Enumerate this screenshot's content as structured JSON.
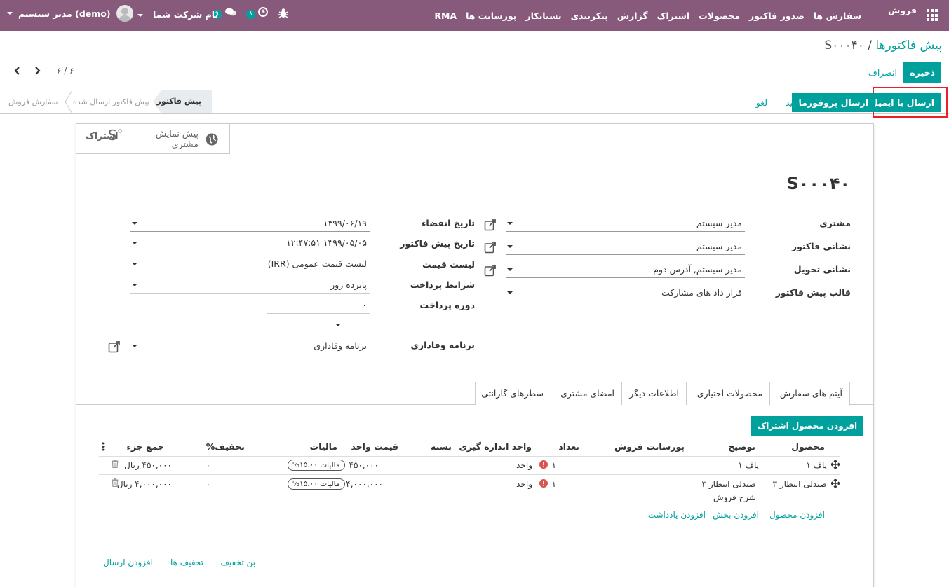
{
  "navbar": {
    "app_name": "فروش",
    "menu": [
      "سفارش ها",
      "صدور فاکتور",
      "محصولات",
      "اشتراک",
      "گزارش",
      "پیکربندی",
      "بستانکار",
      "پورسانت ها",
      "RMA"
    ],
    "user_name": "مدیر سیستم (demo)",
    "company_name": "نام شرکت شما",
    "messages_count": "۹",
    "activities_count": "۸"
  },
  "breadcrumb": {
    "parent": "پیش فاکتورها",
    "separator": "/",
    "current": "S۰۰۰۴۰"
  },
  "pager": {
    "value": "۶ / ۶"
  },
  "actions": {
    "save": "ذخیره",
    "discard": "انصراف"
  },
  "header_buttons": {
    "send_email": "ارسال با ایمیل",
    "send_proforma": "ارسال پروفورما",
    "confirm": "تایید",
    "cancel": "لغو"
  },
  "statusbar": [
    "پیش فاکتور",
    "پیش فاکتور ارسال شده",
    "سفارش فروش"
  ],
  "smart_buttons": {
    "preview_line1": "پیش نمایش",
    "preview_line2": "مشتری",
    "follow": "اشتراک"
  },
  "record_name": "S۰۰۰۴۰",
  "left_group": {
    "customer": {
      "label": "مشتری",
      "value": "مدیر سیستم"
    },
    "invoice_address": {
      "label": "نشانی فاکتور",
      "value": "مدیر سیستم"
    },
    "delivery_address": {
      "label": "نشانی تحویل",
      "value": "مدیر سیستم, آدرس دوم"
    },
    "quote_template": {
      "label": "قالب پیش فاکتور",
      "value": "قرار داد های مشارکت"
    }
  },
  "right_group": {
    "expiration": {
      "label": "تاریخ انقضاء",
      "value": "۱۳۹۹/۰۶/۱۹"
    },
    "quote_date": {
      "label": "تاریخ پیش فاکتور",
      "value": "۱۳۹۹/۰۵/۰۵ ۱۲:۴۷:۵۱"
    },
    "pricelist": {
      "label": "لیست قیمت",
      "value": "لیست قیمت عمومی (IRR)"
    },
    "payment_terms": {
      "label": "شرایط پرداخت",
      "value": "پانزده روز"
    },
    "payment_period": {
      "label": "دوره پرداخت",
      "value": "۰"
    },
    "loyalty": {
      "label": "برنامه وفاداری",
      "value": "برنامه وفاداری"
    }
  },
  "tabs": [
    "آیتم های سفارش",
    "محصولات اختیاری",
    "اطلاعات دیگر",
    "امضای مشتری",
    "سطرهای گارانتی"
  ],
  "add_subscription_product": "افزودن محصول اشتراک",
  "table": {
    "headers": {
      "product": "محصول",
      "description": "توضیح",
      "commission": "پورسانت فروش",
      "qty": "تعداد",
      "uom": "واحد اندازه گیری",
      "package": "بسته",
      "unit_price": "قیمت واحد",
      "taxes": "مالیات",
      "discount": "تخفیف%",
      "subtotal": "جمع جزء"
    },
    "rows": [
      {
        "product": "پاف ۱",
        "description": "پاف ۱",
        "qty": "۱",
        "uom": "واحد",
        "unit_price": "۴۵۰,۰۰۰",
        "tax": "مالیات ۱۵.۰۰%",
        "discount": "۰",
        "subtotal": "۴۵۰,۰۰۰ ریال"
      },
      {
        "product": "صندلی انتظار ۳",
        "description": "صندلی انتظار ۳",
        "description2": "شرح فروش",
        "qty": "۱",
        "uom": "واحد",
        "unit_price": "۴,۰۰۰,۰۰۰",
        "tax": "مالیات ۱۵.۰۰%",
        "discount": "۰",
        "subtotal": "۴,۰۰۰,۰۰۰ ریال"
      }
    ],
    "add_product": "افزودن محصول",
    "add_section": "افزودن بخش",
    "add_note": "افزودن یادداشت"
  },
  "bottom_links": {
    "coupon": "بن تخفیف",
    "promotions": "تخفیف ها",
    "add_shipping": "افزودن ارسال"
  },
  "colors": {
    "navbar": "#875a7b",
    "accent": "#00a09d",
    "highlight": "#e8202a"
  }
}
